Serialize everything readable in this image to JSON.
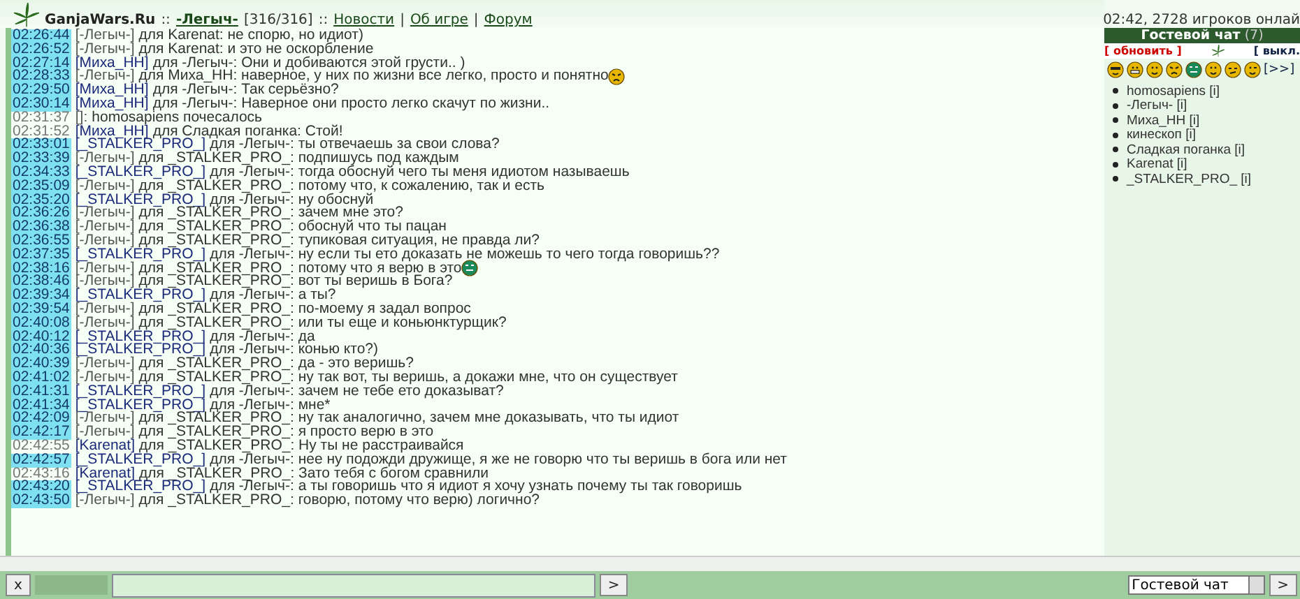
{
  "header": {
    "site": "GanjaWars.Ru",
    "sep1": "::",
    "user": "-Легыч-",
    "hp": "[316/316]",
    "sep2": "::",
    "links": [
      {
        "label": "Новости"
      },
      {
        "separator": "|",
        "label": "Об игре"
      },
      {
        "separator": "|",
        "label": "Форум"
      }
    ],
    "status": "02:42, 2728 игроков онлай"
  },
  "messages": [
    {
      "time": "02:26:44",
      "highlighted": true,
      "sender": "[-Легыч-]",
      "is_self": true,
      "text": "для Karenat: не спорю, но идиот)"
    },
    {
      "time": "02:26:52",
      "highlighted": true,
      "sender": "[-Легыч-]",
      "is_self": true,
      "text": "для Karenat: и это не оскорбление"
    },
    {
      "time": "02:27:14",
      "highlighted": true,
      "sender": "[Миха_НН]",
      "is_self": false,
      "text": "для -Легыч-: Они и добиваются этой грусти.. )"
    },
    {
      "time": "02:28:33",
      "highlighted": true,
      "sender": "[-Легыч-]",
      "is_self": true,
      "text": "для Миха_НН: наверное, у них по жизни все легко, просто и понятно",
      "emoticon": {
        "kind": "frown"
      }
    },
    {
      "time": "02:29:50",
      "highlighted": true,
      "sender": "[Миха_НН]",
      "is_self": false,
      "text": "для -Легыч-: Так серьёзно?"
    },
    {
      "time": "02:30:14",
      "highlighted": true,
      "sender": "[Миха_НН]",
      "is_self": false,
      "text": "для -Легыч-: Наверное они просто легко скачут по жизни.."
    },
    {
      "time": "02:31:37",
      "highlighted": false,
      "sender": "[]:",
      "is_self": true,
      "text": "homosapiens почесалось"
    },
    {
      "time": "02:31:52",
      "highlighted": false,
      "sender": "[Миха_НН]",
      "is_self": false,
      "text": "для Сладкая поганка: Стой!"
    },
    {
      "time": "02:33:01",
      "highlighted": true,
      "sender": "[_STALKER_PRO_]",
      "is_self": false,
      "text": "для -Легыч-: ты отвечаешь за свои слова?"
    },
    {
      "time": "02:33:39",
      "highlighted": true,
      "sender": "[-Легыч-]",
      "is_self": true,
      "text": "для _STALKER_PRO_: подпишусь под каждым"
    },
    {
      "time": "02:34:33",
      "highlighted": true,
      "sender": "[_STALKER_PRO_]",
      "is_self": false,
      "text": "для -Легыч-: тогда обоснуй чего ты меня идиотом называешь"
    },
    {
      "time": "02:35:09",
      "highlighted": true,
      "sender": "[-Легыч-]",
      "is_self": true,
      "text": "для _STALKER_PRO_: потому что, к сожалению, так и есть"
    },
    {
      "time": "02:35:20",
      "highlighted": true,
      "sender": "[_STALKER_PRO_]",
      "is_self": false,
      "text": "для -Легыч-: ну обоснуй"
    },
    {
      "time": "02:36:26",
      "highlighted": true,
      "sender": "[-Легыч-]",
      "is_self": true,
      "text": "для _STALKER_PRO_: зачем мне это?"
    },
    {
      "time": "02:36:38",
      "highlighted": true,
      "sender": "[-Легыч-]",
      "is_self": true,
      "text": "для _STALKER_PRO_: обоснуй что ты пацан"
    },
    {
      "time": "02:36:55",
      "highlighted": true,
      "sender": "[-Легыч-]",
      "is_self": true,
      "text": "для _STALKER_PRO_: тупиковая ситуация, не правда ли?"
    },
    {
      "time": "02:37:35",
      "highlighted": true,
      "sender": "[_STALKER_PRO_]",
      "is_self": false,
      "text": "для -Легыч-: ну если ты ето доказать не можешь то чего тогда говоришь??"
    },
    {
      "time": "02:38:16",
      "highlighted": true,
      "sender": "[-Легыч-]",
      "is_self": true,
      "text": "для _STALKER_PRO_: потому что я верю в это",
      "emoticon": {
        "kind": "green"
      }
    },
    {
      "time": "02:38:46",
      "highlighted": true,
      "sender": "[-Легыч-]",
      "is_self": true,
      "text": "для _STALKER_PRO_: вот ты веришь в Бога?"
    },
    {
      "time": "02:39:34",
      "highlighted": true,
      "sender": "[_STALKER_PRO_]",
      "is_self": false,
      "text": "для -Легыч-: а ты?"
    },
    {
      "time": "02:39:54",
      "highlighted": true,
      "sender": "[-Легыч-]",
      "is_self": true,
      "text": "для _STALKER_PRO_: по-моему я задал вопрос"
    },
    {
      "time": "02:40:08",
      "highlighted": true,
      "sender": "[-Легыч-]",
      "is_self": true,
      "text": "для _STALKER_PRO_: или ты еще и коньюнктурщик?"
    },
    {
      "time": "02:40:12",
      "highlighted": true,
      "sender": "[_STALKER_PRO_]",
      "is_self": false,
      "text": "для -Легыч-: да"
    },
    {
      "time": "02:40:36",
      "highlighted": true,
      "sender": "[_STALKER_PRO_]",
      "is_self": false,
      "text": "для -Легыч-: конью кто?)"
    },
    {
      "time": "02:40:39",
      "highlighted": true,
      "sender": "[-Легыч-]",
      "is_self": true,
      "text": "для _STALKER_PRO_: да - это веришь?"
    },
    {
      "time": "02:41:02",
      "highlighted": true,
      "sender": "[-Легыч-]",
      "is_self": true,
      "text": "для _STALKER_PRO_: ну так вот, ты веришь, а докажи мне, что он существует"
    },
    {
      "time": "02:41:31",
      "highlighted": true,
      "sender": "[_STALKER_PRO_]",
      "is_self": false,
      "text": "для -Легыч-: зачем не тебе ето доказыват?"
    },
    {
      "time": "02:41:34",
      "highlighted": true,
      "sender": "[_STALKER_PRO_]",
      "is_self": false,
      "text": "для -Легыч-: мне*"
    },
    {
      "time": "02:42:09",
      "highlighted": true,
      "sender": "[-Легыч-]",
      "is_self": true,
      "text": "для _STALKER_PRO_: ну так аналогично, зачем мне доказывать, что ты идиот"
    },
    {
      "time": "02:42:17",
      "highlighted": true,
      "sender": "[-Легыч-]",
      "is_self": true,
      "text": "для _STALKER_PRO_: я просто верю в это"
    },
    {
      "time": "02:42:55",
      "highlighted": false,
      "sender": "[Karenat]",
      "is_self": false,
      "text": "для _STALKER_PRO_: Ну ты не расстраивайся"
    },
    {
      "time": "02:42:57",
      "highlighted": true,
      "sender": "[_STALKER_PRO_]",
      "is_self": false,
      "text": "для -Легыч-: нее ну подожди дружище, я же не говорю что ты веришь в бога или нет"
    },
    {
      "time": "02:43:16",
      "highlighted": false,
      "sender": "[Karenat]",
      "is_self": false,
      "text": "для _STALKER_PRO_: Зато тебя с богом сравнили"
    },
    {
      "time": "02:43:20",
      "highlighted": true,
      "sender": "[_STALKER_PRO_]",
      "is_self": false,
      "text": "для -Легыч-: а ты говоришь что я идиот я хочу узнать почему ты так говоришь"
    },
    {
      "time": "02:43:50",
      "highlighted": true,
      "sender": "[-Легыч-]",
      "is_self": true,
      "text": "для _STALKER_PRO_: говорю, потому что верю) логично?"
    }
  ],
  "guest_chat": {
    "title": "Гостевой чат",
    "count": "(7)",
    "refresh": "[ обновить ]",
    "off": "[ выкл.",
    "more": "[>>]",
    "smileys": [
      {
        "kind": "cool"
      },
      {
        "kind": "grin"
      },
      {
        "kind": "smile"
      },
      {
        "kind": "frown"
      },
      {
        "kind": "green"
      },
      {
        "kind": "smile"
      },
      {
        "kind": "smirk"
      },
      {
        "kind": "wink"
      }
    ],
    "users": [
      {
        "name": "homosapiens",
        "info": "[i]"
      },
      {
        "name": "-Легыч-",
        "info": "[i]"
      },
      {
        "name": "Миха_НН",
        "info": "[i]"
      },
      {
        "name": "кинескоп",
        "info": "[i]"
      },
      {
        "name": "Сладкая поганка",
        "info": "[i]"
      },
      {
        "name": "Karenat",
        "info": "[i]"
      },
      {
        "name": "_STALKER_PRO_",
        "info": "[i]"
      }
    ]
  },
  "input_bar": {
    "clear_button": "x",
    "send_button": ">",
    "channel": "Гостевой чат",
    "go_button": ">"
  }
}
